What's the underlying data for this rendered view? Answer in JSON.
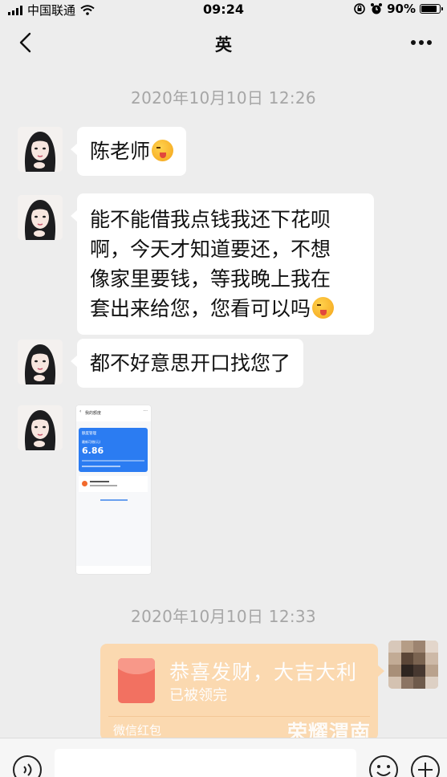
{
  "status_bar": {
    "carrier": "中国联通",
    "time": "09:24",
    "battery": "90%",
    "battery_level": 0.9
  },
  "nav": {
    "title": "英",
    "back_icon": "chevron-left-icon",
    "more_icon": "more-dots-icon"
  },
  "messages": {
    "timestamp_1": "2020年10月10日 12:26",
    "msg_1": "陈老师",
    "msg_2_lines": [
      "能不能借我点钱我还下花呗",
      "啊，今天才知道要还，不想",
      "像家里要钱，等我晚上我在",
      "套出来给您，您看可以吗"
    ],
    "msg_3": "都不好意思开口找您了",
    "timestamp_2": "2020年10月10日 12:33"
  },
  "image_message": {
    "header": "我的额度",
    "card_label": "额度管理",
    "card_sub": "最新可借(元)",
    "amount": "6.86"
  },
  "red_packet": {
    "title": "恭喜发财，大吉大利",
    "status": "已被领完",
    "brand": "微信红包"
  },
  "watermark": "荣耀渭南",
  "colors": {
    "background": "#ededed",
    "bubble": "#ffffff",
    "red_packet": "#fcd8ad",
    "timestamp": "#a6a6a6"
  }
}
